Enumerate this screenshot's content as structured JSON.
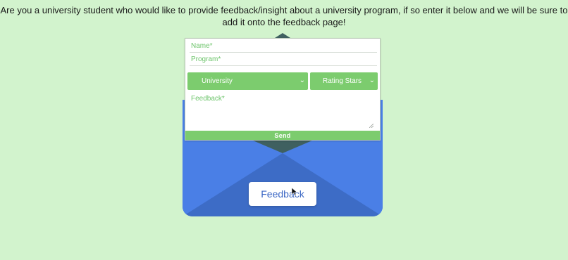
{
  "intro": {
    "text": "Are you a university student who would like to provide feedback/insight about a university program, if so enter it below and we will be sure to add it onto the feedback page!"
  },
  "form": {
    "name_placeholder": "Name*",
    "program_placeholder": "Program*",
    "university_select": "University",
    "rating_select": "Rating Stars",
    "feedback_placeholder": "Feedback*",
    "send_label": "Send"
  },
  "envelope": {
    "toggle_label": "Feedback"
  },
  "icons": {
    "chevron": "chevron-down-icon",
    "cursor": "mouse-pointer-icon",
    "grip": "resize-grip-icon"
  },
  "colors": {
    "page_background": "#d2f3cd",
    "accent_green": "#7ccc6e",
    "envelope_blue": "#4f84ea",
    "envelope_dark_blue": "#3d6cc6",
    "flap_dark": "#3f6060",
    "button_text_blue": "#3b67c4"
  }
}
